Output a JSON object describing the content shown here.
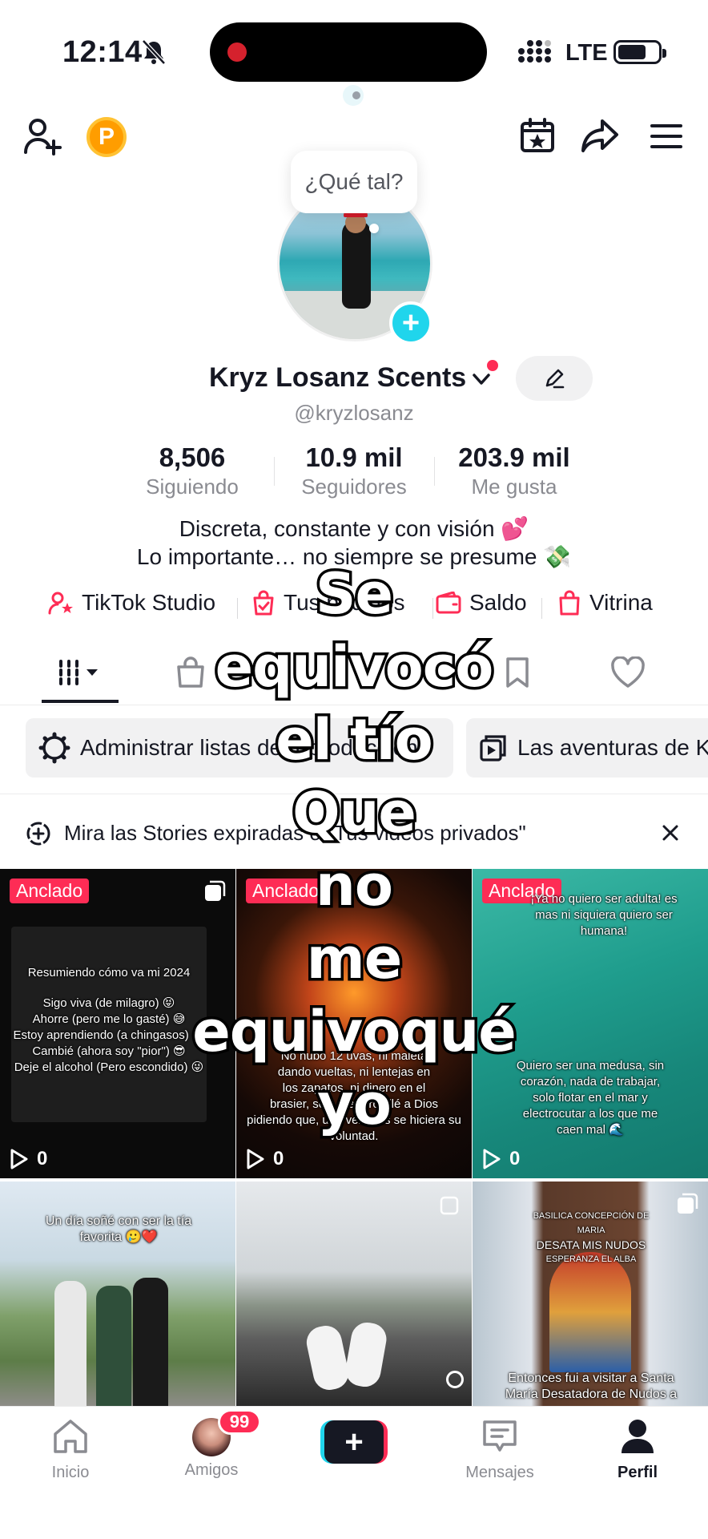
{
  "status_bar": {
    "time": "12:14",
    "network": "LTE"
  },
  "top_nav": {
    "add_friend_icon": "person-plus-icon",
    "coin_label": "P",
    "calendar_icon": "calendar-star-icon",
    "share_icon": "share-arrow-icon",
    "menu_icon": "hamburger-menu-icon"
  },
  "profile": {
    "bubble": "¿Qué tal?",
    "name": "Kryz Losanz Scents",
    "handle": "@kryzlosanz",
    "stats": [
      {
        "value": "8,506",
        "label": "Siguiendo"
      },
      {
        "value": "10.9 mil",
        "label": "Seguidores"
      },
      {
        "value": "203.9 mil",
        "label": "Me gusta"
      }
    ],
    "bio_line1": "Discreta, constante y con visión 💕",
    "bio_line2": "Lo importante… no siempre se presume 💸"
  },
  "links": [
    {
      "label": "TikTok Studio",
      "icon": "person-star-icon"
    },
    {
      "label": "Tus pedidos",
      "icon": "bag-check-icon"
    },
    {
      "label": "Saldo",
      "icon": "wallet-icon"
    },
    {
      "label": "Vitrina",
      "icon": "shopping-bag-icon"
    }
  ],
  "chips": [
    {
      "label": "Administrar listas de reproducción",
      "icon": "gear-icon"
    },
    {
      "label": "Las aventuras de Kryz",
      "icon": "playlist-icon"
    }
  ],
  "banner": {
    "text": "Mira las Stories expiradas o \"Tus videos privados\""
  },
  "grid": [
    {
      "pinned": "Anclado",
      "views": "0",
      "text": [
        "Resumiendo cómo va mi 2024",
        "Sigo viva (de milagro) 😝",
        "Ahorre (pero me lo gasté) 😅",
        "Estoy aprendiendo (a chingasos) 😱",
        "Cambié (ahora soy \"pior\") 😎",
        "Deje el alcohol (Pero escondido) 😜"
      ]
    },
    {
      "pinned": "Anclado",
      "views": "0",
      "text": [
        "No hubo 12 uvas, ni maleta",
        "dando vueltas, ni lentejas en",
        "los zapatos, ni dinero en el",
        "brasier, solo me arrodillé a Dios",
        "pidiendo que, una vez más se hiciera su",
        "voluntad."
      ]
    },
    {
      "pinned": "Anclado",
      "views": "0",
      "text_top": [
        "¡Ya no quiero ser adulta! es",
        "mas ni siquiera quiero ser",
        "humana!"
      ],
      "text": [
        "Quiero ser una medusa, sin",
        "corazón, nada de trabajar,",
        "solo flotar en el mar y",
        "electrocutar a los que me",
        "caen mal 🌊"
      ]
    },
    {
      "text": [
        "Un día soñé con ser la tía",
        "favorita 🥲❤️"
      ]
    },
    {
      "text": []
    },
    {
      "text": [
        "Entonces fui a visitar a Santa",
        "María Desatadora de Nudos a"
      ],
      "sign": [
        "BASILICA CONCEPCIÓN DE MARIA",
        "DESATA MIS NUDOS",
        "ESPERANZA EL ALBA"
      ]
    }
  ],
  "bottom_nav": [
    {
      "label": "Inicio",
      "icon": "home-icon"
    },
    {
      "label": "Amigos",
      "icon": "friends-avatar",
      "badge": "99"
    },
    {
      "label": "",
      "icon": "create-plus-icon"
    },
    {
      "label": "Mensajes",
      "icon": "message-icon"
    },
    {
      "label": "Perfil",
      "icon": "person-icon"
    }
  ],
  "overlay_caption": [
    "Se",
    "equivocó",
    "el tío",
    "Que",
    "no",
    "me",
    "equivoqué",
    "yo"
  ],
  "colors": {
    "accent": "#fe2c55",
    "cyan": "#20d5ec",
    "text": "#161823",
    "muted": "#8a8b91"
  }
}
